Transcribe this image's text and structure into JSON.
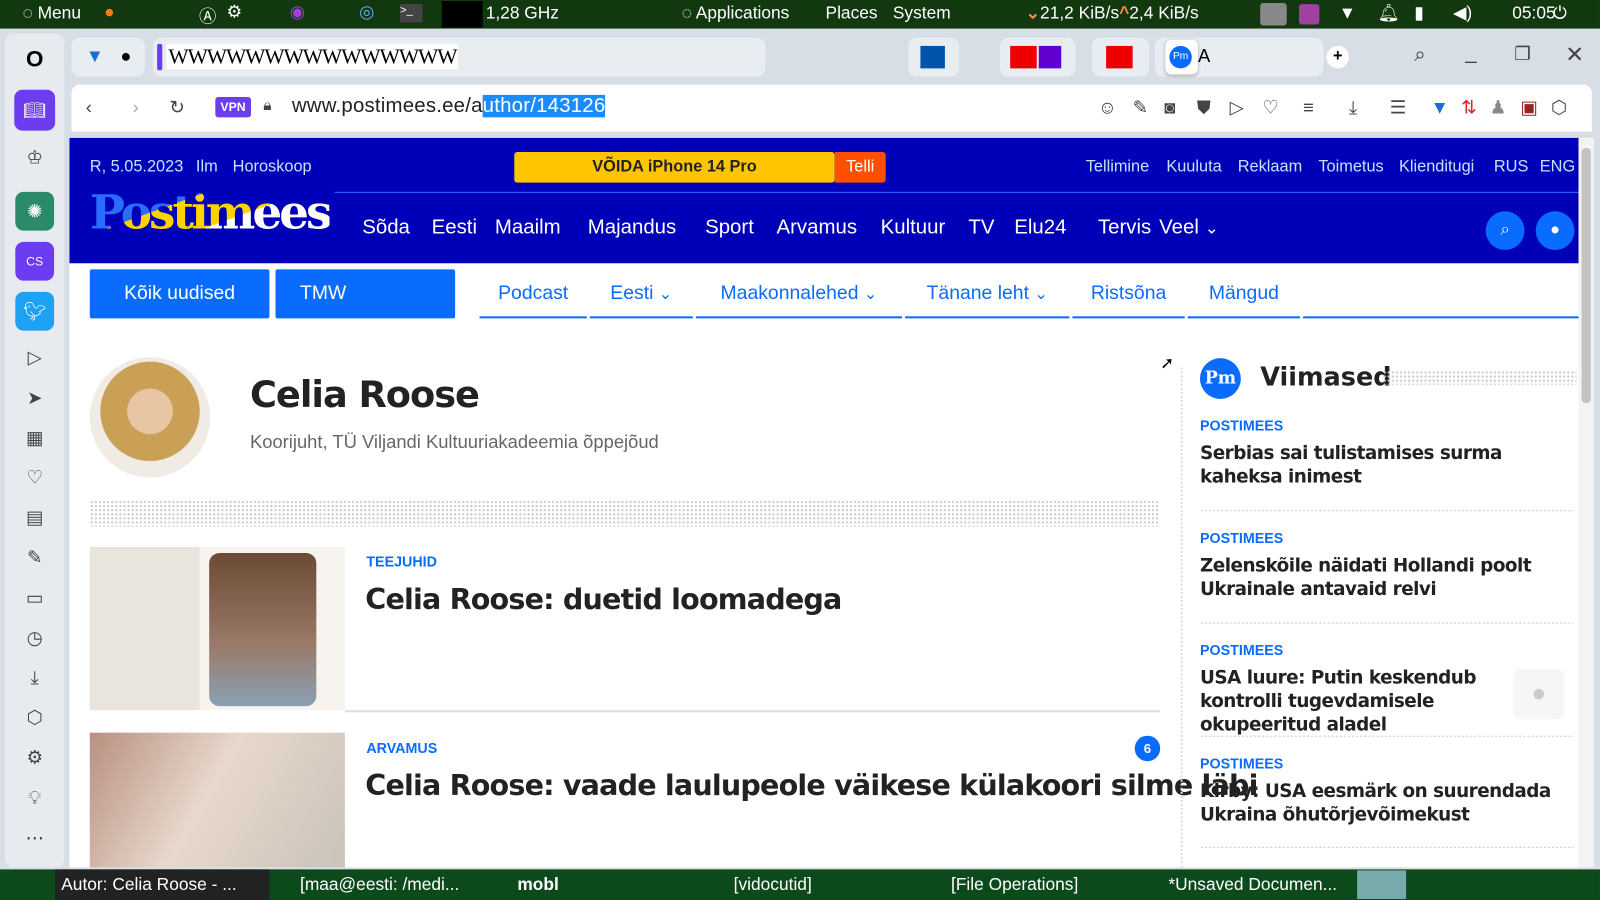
{
  "os_panel": {
    "menu": "Menu",
    "cpu": "1,28 GHz",
    "applications": "Applications",
    "places": "Places",
    "system": "System",
    "net_down": "21,2 KiB/s",
    "net_up": "2,4 KiB/s",
    "clock": "05:05"
  },
  "browser": {
    "url_plain": "www.postimees.ee/a",
    "url_selected": "uthor/143126",
    "vpn": "VPN",
    "tab_strip": "WWWWWWWWWWWWWWW",
    "pinned_label": "A"
  },
  "site": {
    "date": "R, 5.05.2023",
    "ilm": "Ilm",
    "horoskoop": "Horoskoop",
    "promo": "VÕIDA iPhone 14 Pro",
    "promo_btn": "Telli",
    "top_links": [
      "Tellimine",
      "Kuuluta",
      "Reklaam",
      "Toimetus",
      "Klienditugi",
      "RUS",
      "ENG"
    ],
    "logo": "Postimees",
    "nav": [
      "Sõda",
      "Eesti",
      "Maailm",
      "Majandus",
      "Sport",
      "Arvamus",
      "Kultuur",
      "TV",
      "Elu24",
      "Tervis",
      "Veel"
    ],
    "sub_buttons": [
      "Kõik uudised",
      "TMW"
    ],
    "sub_nav": [
      "Podcast",
      "Eesti",
      "Maakonnalehed",
      "Tänane leht",
      "Ristsõna",
      "Mängud"
    ]
  },
  "author": {
    "name": "Celia Roose",
    "bio": "Koorijuht, TÜ Viljandi Kultuuriakadeemia õppejõud"
  },
  "articles": [
    {
      "tag": "TEEJUHID",
      "title": "Celia Roose: duetid loomadega"
    },
    {
      "tag": "ARVAMUS",
      "title": "Celia Roose: vaade laulupeole väikese külakoori silme läbi",
      "comments": "6"
    }
  ],
  "latest": {
    "logo": "Pm",
    "title": "Viimased",
    "items": [
      {
        "tag": "POSTIMEES",
        "title": "Serbias sai tulistamises surma kaheksa inimest"
      },
      {
        "tag": "POSTIMEES",
        "title": "Zelenskõile näidati Hollandi poolt Ukrainale antavaid relvi"
      },
      {
        "tag": "POSTIMEES",
        "title": "USA luure: Putin keskendub kontrolli tugevdamisele okupeeritud aladel"
      },
      {
        "tag": "POSTIMEES",
        "title": "Kirby: USA eesmärk on suurendada Ukraina õhutõrjevõimekust"
      }
    ]
  },
  "taskbar": [
    "Autor: Celia Roose - ...",
    "[maa@eesti: /medi...",
    "mobl",
    "[vidocutid]",
    "[File Operations]",
    "*Unsaved Documen..."
  ],
  "colors": {
    "brand": "#0000b8",
    "accent": "#0a6cff",
    "promo": "#ffc600",
    "telli": "#ff4f00"
  }
}
